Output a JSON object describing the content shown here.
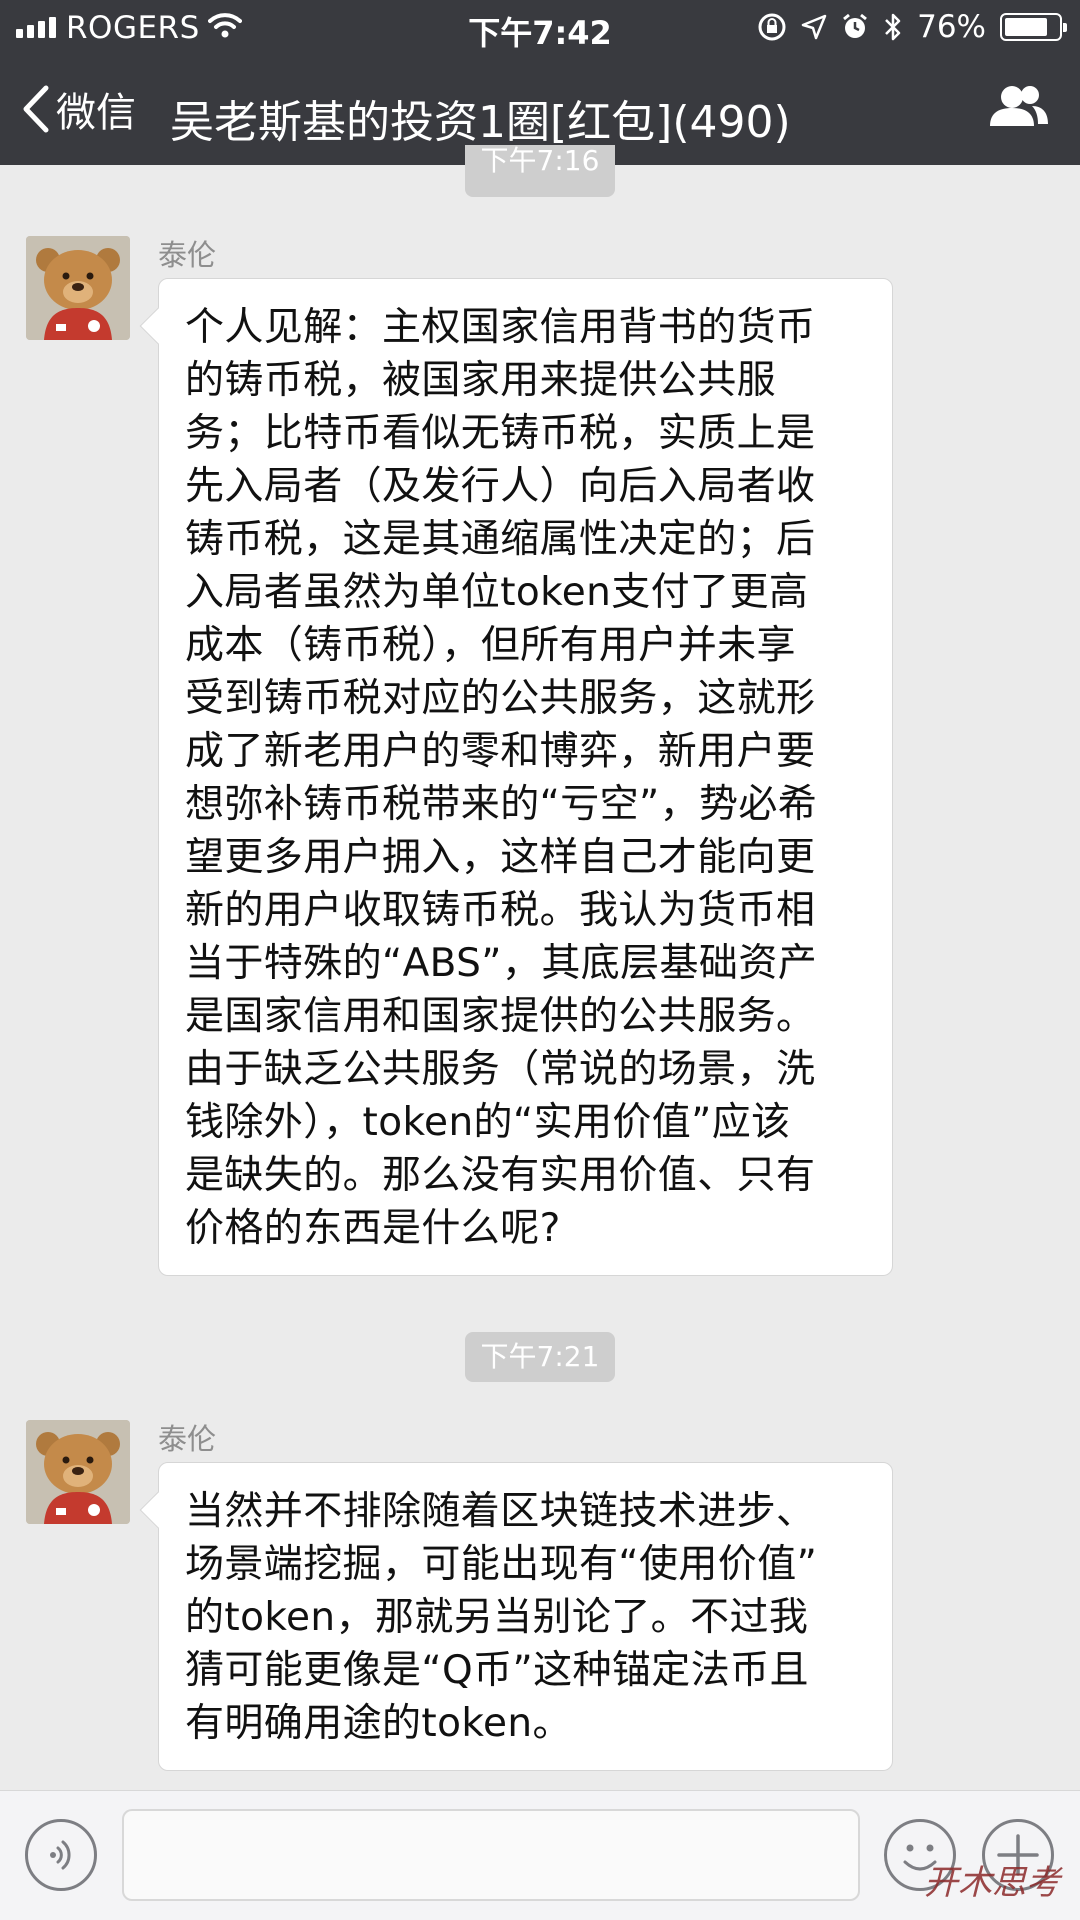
{
  "status_bar": {
    "carrier": "ROGERS",
    "time": "下午7:42",
    "battery": "76%",
    "battery_level": 0.76
  },
  "nav": {
    "back_label": "微信",
    "title": "吴老斯基的投资1圈[红包](490)"
  },
  "messages": {
    "top_timestamp": "下午7:16",
    "m1": {
      "sender": "泰伦",
      "lines": [
        "个人见解：主权国家信用背书的货币",
        "的铸币税，被国家用来提供公共服",
        "务；比特币看似无铸币税，实质上是",
        "先入局者（及发行人）向后入局者收",
        "铸币税，这是其通缩属性决定的；后",
        "入局者虽然为单位token支付了更高",
        "成本（铸币税），但所有用户并未享",
        "受到铸币税对应的公共服务，这就形",
        "成了新老用户的零和博弈，新用户要",
        "想弥补铸币税带来的“亏空”，势必希",
        "望更多用户拥入，这样自己才能向更",
        "新的用户收取铸币税。我认为货币相",
        "当于特殊的“ABS”，其底层基础资产",
        "是国家信用和国家提供的公共服务。",
        "由于缺乏公共服务（常说的场景，洗",
        "钱除外），token的“实用价值”应该",
        "是缺失的。那么没有实用价值、只有",
        "价格的东西是什么呢?"
      ]
    },
    "timestamp_2": "下午7:21",
    "m2": {
      "sender": "泰伦",
      "lines": [
        "当然并不排除随着区块链技术进步、",
        "场景端挖掘，可能出现有“使用价值”",
        "的token，那就另当别论了。不过我",
        "猜可能更像是“Q币”这种锚定法币且",
        "有明确用途的token。"
      ]
    }
  },
  "watermark": "开木思考"
}
